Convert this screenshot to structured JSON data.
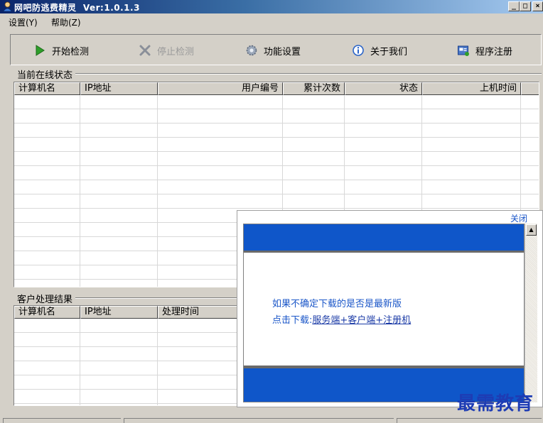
{
  "window": {
    "title": "网吧防逃费精灵  Ver:1.0.1.3",
    "min_label": "_",
    "max_label": "□",
    "close_label": "×"
  },
  "menu": [
    {
      "label": "设置(Y)"
    },
    {
      "label": "帮助(Z)"
    }
  ],
  "toolbar": {
    "start": "开始检测",
    "stop": "停止检测",
    "settings": "功能设置",
    "about": "关于我们",
    "register": "程序注册"
  },
  "online": {
    "label": "当前在线状态",
    "columns": [
      "计算机名",
      "IP地址",
      "用户编号",
      "累计次数",
      "状态",
      "上机时间"
    ]
  },
  "results": {
    "label": "客户处理结果",
    "columns": [
      "计算机名",
      "IP地址",
      "处理时间"
    ]
  },
  "popup": {
    "close_label": "关闭",
    "message": "如果不确定下载的是否是最新版",
    "download_prefix": "点击下载:",
    "download_link": "服务端+客户端+注册机"
  },
  "watermark": "最需教育",
  "colors": {
    "title_bar": "#0a246a",
    "popup_band": "#0f56c9",
    "link": "#1a56c8"
  }
}
